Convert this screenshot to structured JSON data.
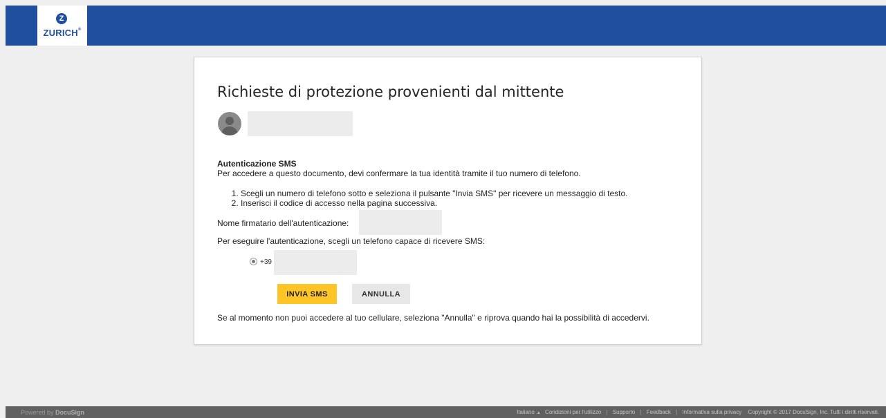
{
  "header": {
    "logo_text": "ZURICH",
    "logo_mark": "zurich-z-logo",
    "brand_color": "#1f4f9e"
  },
  "card": {
    "title": "Richieste di protezione provenienti dal mittente",
    "sms_heading": "Autenticazione SMS",
    "sms_description": "Per accedere a questo documento, devi confermare la tua identità tramite il tuo numero di telefono.",
    "steps": [
      "Scegli un numero di telefono sotto e seleziona il pulsante \"Invia SMS\" per ricevere un messaggio di testo.",
      "Inserisci il codice di accesso nella pagina successiva."
    ],
    "signer_label": "Nome firmatario dell'autenticazione:",
    "choose_phone_label": "Per eseguire l'autenticazione, scegli un telefono capace di ricevere SMS:",
    "phone_prefix": "+39",
    "phone_selected": true,
    "send_button": "INVIA SMS",
    "cancel_button": "ANNULLA",
    "bottom_note": "Se al momento non puoi accedere al tuo cellulare, seleziona \"Annulla\" e riprova quando hai la possibilità di accedervi.",
    "accent_color": "#ffc425"
  },
  "footer": {
    "powered_by": "Powered by",
    "powered_brand": "DocuSign",
    "language": "Italiano",
    "language_caret": "chevron-up-icon",
    "links": [
      "Condizioni per l'utilizzo",
      "Supporto",
      "Feedback",
      "Informativa sulla privacy"
    ],
    "copyright": "Copyright © 2017 DocuSign, Inc. Tutti i diritti riservati."
  }
}
